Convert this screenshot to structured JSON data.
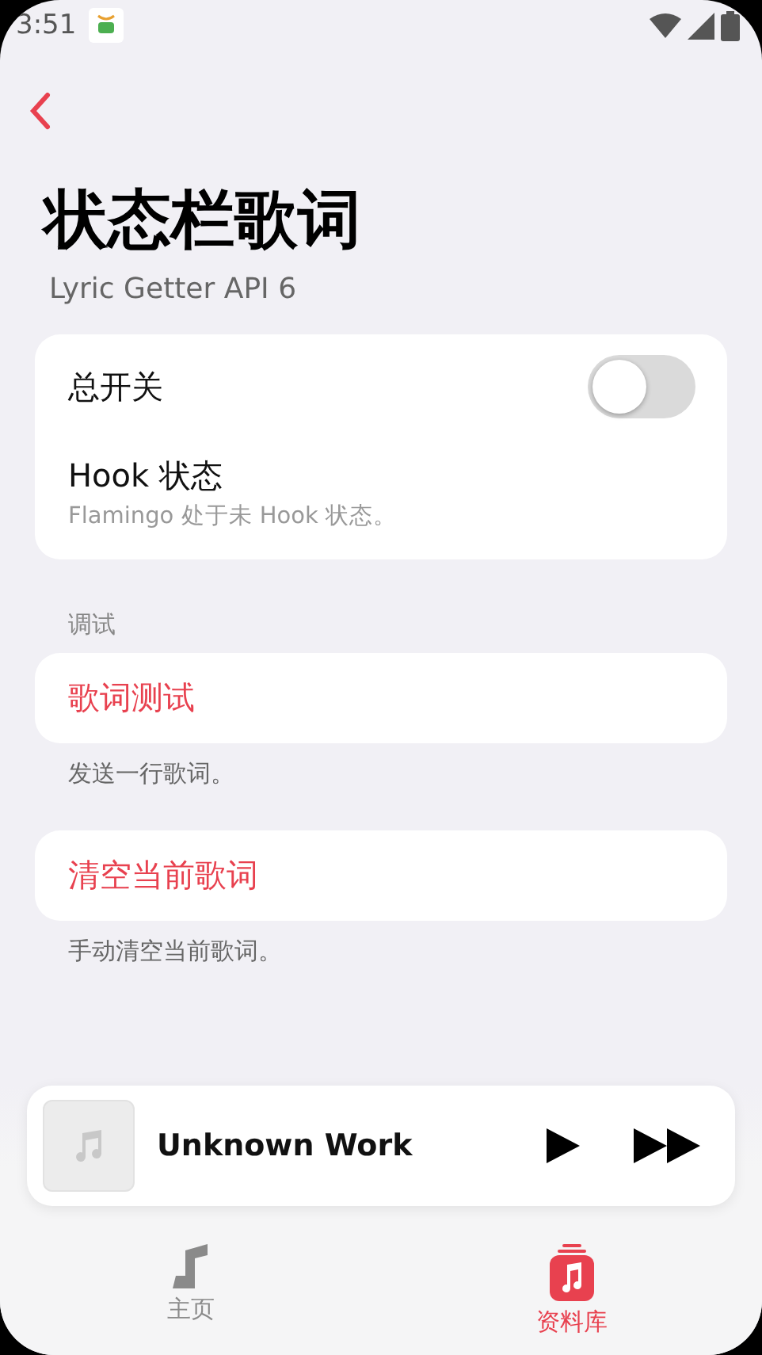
{
  "status_bar": {
    "time": "3:51"
  },
  "header": {
    "title": "状态栏歌词",
    "subtitle": "Lyric Getter API 6"
  },
  "settings": [
    {
      "kind": "switch",
      "label": "总开关",
      "on": false
    },
    {
      "kind": "info",
      "label": "Hook 状态",
      "description": "Flamingo 处于未 Hook 状态。"
    }
  ],
  "section": {
    "title": "调试",
    "items": [
      {
        "label": "歌词测试",
        "description": "发送一行歌词。"
      },
      {
        "label": "清空当前歌词",
        "description": "手动清空当前歌词。"
      }
    ]
  },
  "mini_player": {
    "title": "Unknown Work"
  },
  "tabs": [
    {
      "label": "主页",
      "selected": false
    },
    {
      "label": "资料库",
      "selected": true
    }
  ]
}
